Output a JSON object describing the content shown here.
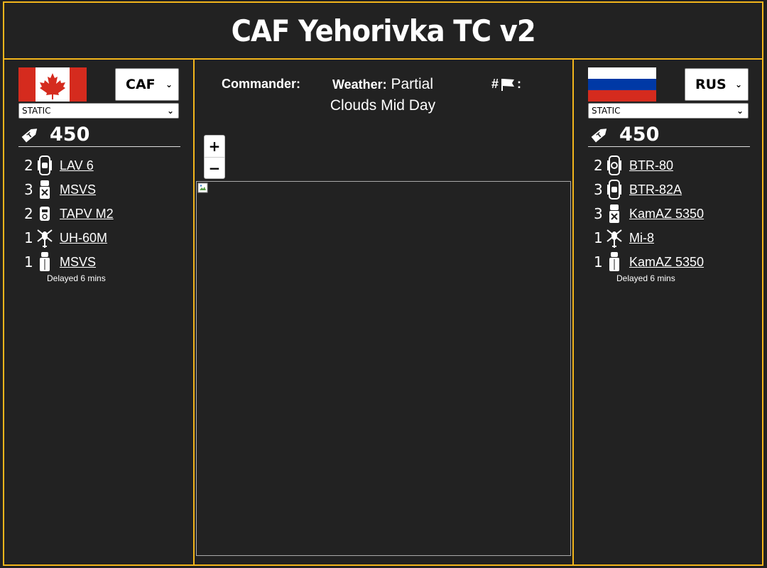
{
  "title": "CAF Yehorivka TC v2",
  "left": {
    "faction": "CAF",
    "mode": "STATIC",
    "points": "450",
    "units": [
      {
        "count": "2",
        "name": "LAV 6",
        "icon": "apc-wheeled-icon"
      },
      {
        "count": "3",
        "name": "MSVS",
        "icon": "logistics-truck-icon"
      },
      {
        "count": "2",
        "name": "TAPV M2",
        "icon": "armored-car-icon"
      },
      {
        "count": "1",
        "name": "UH-60M",
        "icon": "helicopter-icon"
      },
      {
        "count": "1",
        "name": "MSVS",
        "icon": "transport-truck-icon"
      }
    ],
    "delay_note": "Delayed 6 mins"
  },
  "right": {
    "faction": "RUS",
    "mode": "STATIC",
    "points": "450",
    "units": [
      {
        "count": "2",
        "name": "BTR-80",
        "icon": "apc-wheeled-icon"
      },
      {
        "count": "3",
        "name": "BTR-82A",
        "icon": "apc-wheeled-icon"
      },
      {
        "count": "3",
        "name": "KamAZ 5350",
        "icon": "logistics-truck-icon"
      },
      {
        "count": "1",
        "name": "Mi-8",
        "icon": "helicopter-icon"
      },
      {
        "count": "1",
        "name": "KamAZ 5350",
        "icon": "transport-truck-icon"
      }
    ],
    "delay_note": "Delayed 6 mins"
  },
  "center": {
    "commander_label": "Commander:",
    "weather_label": "Weather:",
    "weather_value": "Partial Clouds Mid Day",
    "objectives_prefix": "#",
    "objectives_suffix": ":",
    "zoom_in": "+",
    "zoom_out": "−"
  },
  "colors": {
    "background": "#222222",
    "border_accent": "#f2b51b",
    "canada_red": "#d52b1e",
    "russia_blue": "#0039a6",
    "russia_red": "#d52b1e"
  }
}
